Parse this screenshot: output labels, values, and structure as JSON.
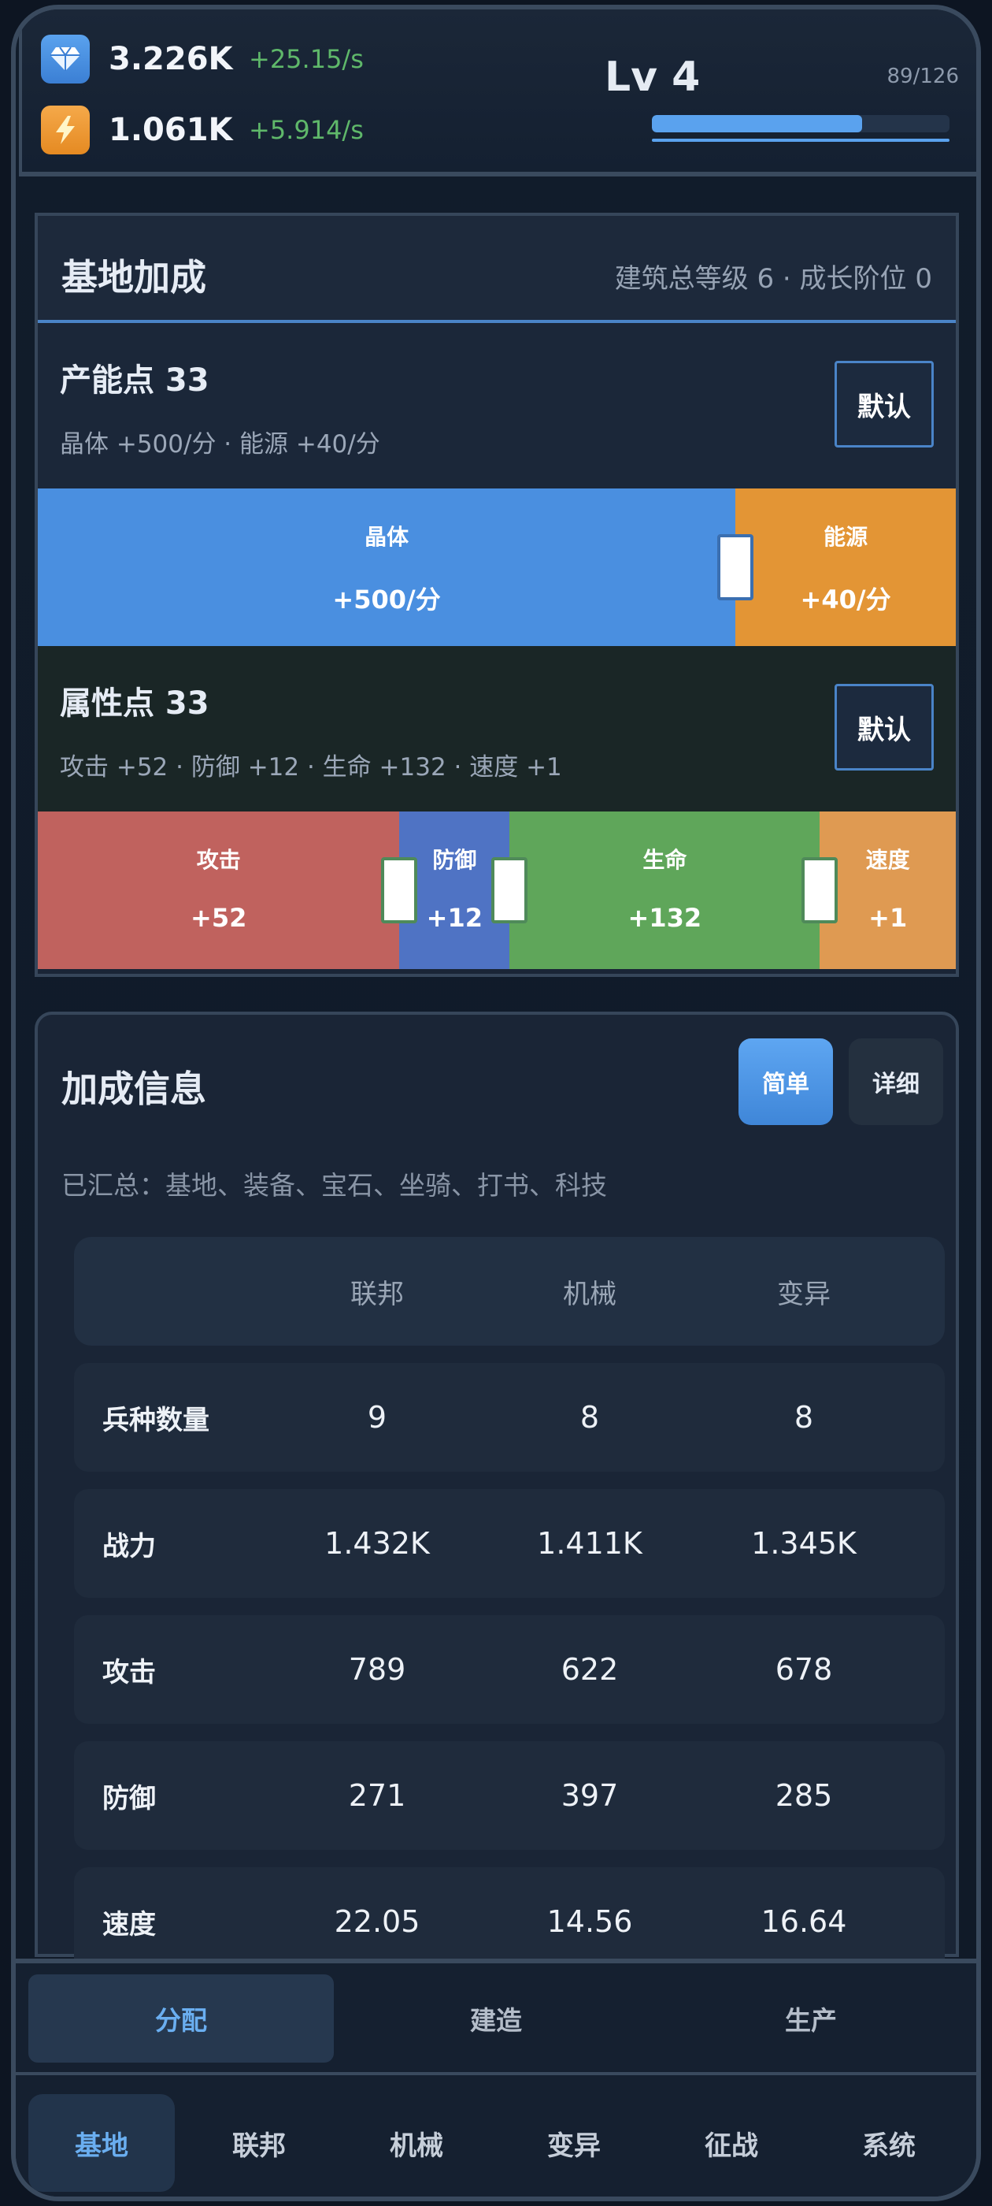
{
  "resources": [
    {
      "icon": "gem-icon",
      "value": "3.226K",
      "rate": "+25.15/s"
    },
    {
      "icon": "lightning-icon",
      "value": "1.061K",
      "rate": "+5.914/s"
    }
  ],
  "level": {
    "label": "Lv 4",
    "xp_text": "89/126",
    "progress": 0.706
  },
  "base_bonus": {
    "title": "基地加成",
    "subtitle": "建筑总等级 6 · 成长阶位 0",
    "production": {
      "title": "产能点 33",
      "desc": "晶体 +500/分 · 能源 +40/分",
      "default_label": "默认",
      "segments": [
        {
          "name": "晶体",
          "value": "+500/分",
          "share": 0.76,
          "color": "#4a8fe0"
        },
        {
          "name": "能源",
          "value": "+40/分",
          "share": 0.24,
          "color": "#e39535"
        }
      ]
    },
    "attributes": {
      "title": "属性点 33",
      "desc": "攻击 +52 · 防御 +12 · 生命 +132 · 速度 +1",
      "default_label": "默认",
      "segments": [
        {
          "name": "攻击",
          "value": "+52",
          "share": 0.394,
          "color": "#c0625e"
        },
        {
          "name": "防御",
          "value": "+12",
          "share": 0.12,
          "color": "#4f73c4"
        },
        {
          "name": "生命",
          "value": "+132",
          "share": 0.338,
          "color": "#5fa65a"
        },
        {
          "name": "速度",
          "value": "+1",
          "share": 0.148,
          "color": "#df9a52"
        }
      ]
    }
  },
  "bonus_info": {
    "title": "加成信息",
    "mode_simple": "简单",
    "mode_detail": "详细",
    "summary": "已汇总：基地、装备、宝石、坐骑、打书、科技",
    "columns": [
      "联邦",
      "机械",
      "变异"
    ],
    "rows": [
      {
        "label": "兵种数量",
        "values": [
          "9",
          "8",
          "8"
        ]
      },
      {
        "label": "战力",
        "values": [
          "1.432K",
          "1.411K",
          "1.345K"
        ]
      },
      {
        "label": "攻击",
        "values": [
          "789",
          "622",
          "678"
        ]
      },
      {
        "label": "防御",
        "values": [
          "271",
          "397",
          "285"
        ]
      },
      {
        "label": "速度",
        "values": [
          "22.05",
          "14.56",
          "16.64"
        ]
      }
    ]
  },
  "sub_tabs": [
    "分配",
    "建造",
    "生产"
  ],
  "main_tabs": [
    "基地",
    "联邦",
    "机械",
    "变异",
    "征战",
    "系统"
  ]
}
